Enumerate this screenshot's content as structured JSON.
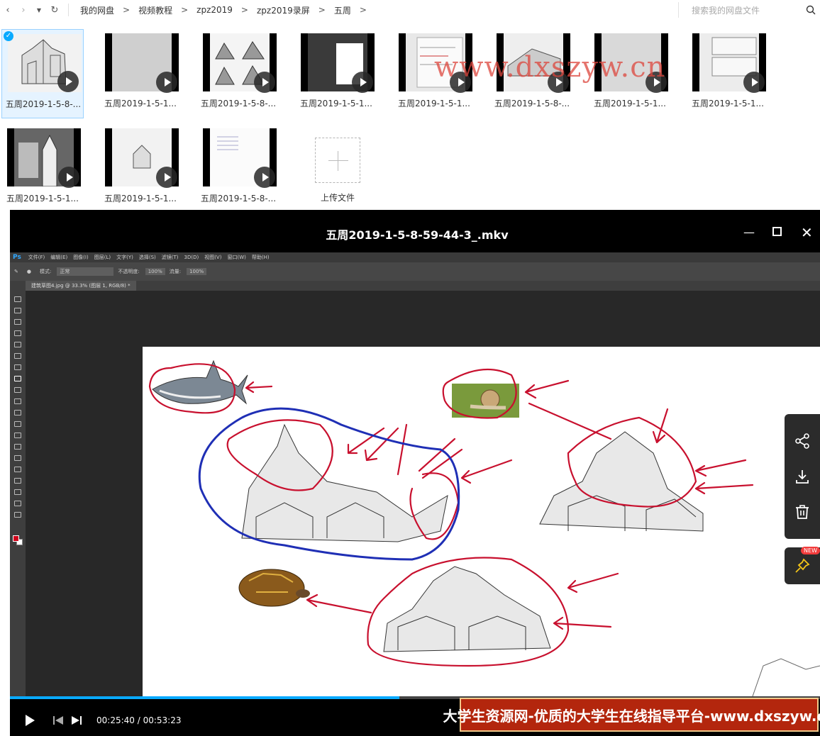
{
  "nav": {
    "breadcrumbs": [
      "我的网盘",
      "视频教程",
      "zpz2019",
      "zpz2019录屏",
      "五周"
    ],
    "search_placeholder": "搜索我的网盘文件"
  },
  "files": [
    {
      "name": "五周2019-1-5-8-...",
      "selected": true
    },
    {
      "name": "五周2019-1-5-1...",
      "selected": false
    },
    {
      "name": "五周2019-1-5-8-...",
      "selected": false
    },
    {
      "name": "五周2019-1-5-1...",
      "selected": false
    },
    {
      "name": "五周2019-1-5-1...",
      "selected": false
    },
    {
      "name": "五周2019-1-5-8-...",
      "selected": false
    },
    {
      "name": "五周2019-1-5-1...",
      "selected": false
    },
    {
      "name": "五周2019-1-5-1...",
      "selected": false
    },
    {
      "name": "五周2019-1-5-1...",
      "selected": false
    },
    {
      "name": "五周2019-1-5-1...",
      "selected": false
    },
    {
      "name": "五周2019-1-5-8-...",
      "selected": false
    }
  ],
  "upload": {
    "label": "上传文件"
  },
  "watermark": "www.dxszyw.cn",
  "player": {
    "title": "五周2019-1-5-8-59-44-3_.mkv",
    "time": "00:25:40 / 00:53:23",
    "progress_fraction": 0.481,
    "banner": "大学生资源网-优质的大学生在线指导平台-www.dxszyw.cn",
    "new_badge": "NEW"
  },
  "photoshop": {
    "logo": "Ps",
    "menus": [
      "文件(F)",
      "编辑(E)",
      "图像(I)",
      "图层(L)",
      "文字(Y)",
      "选择(S)",
      "滤镜(T)",
      "3D(D)",
      "视图(V)",
      "窗口(W)",
      "帮助(H)"
    ],
    "options": {
      "mode_label": "模式:",
      "mode_value": "正常",
      "opacity_label": "不透明度:",
      "opacity_value": "100%",
      "flow_label": "流量:",
      "flow_value": "100%"
    },
    "doc_tab": "建筑草图4.jpg @ 33.3% (图层 1, RGB/8) *"
  },
  "colors": {
    "accent": "#09aaff",
    "banner": "#b3260d",
    "ink_red": "#c8102e",
    "ink_blue": "#1f2fb5"
  }
}
